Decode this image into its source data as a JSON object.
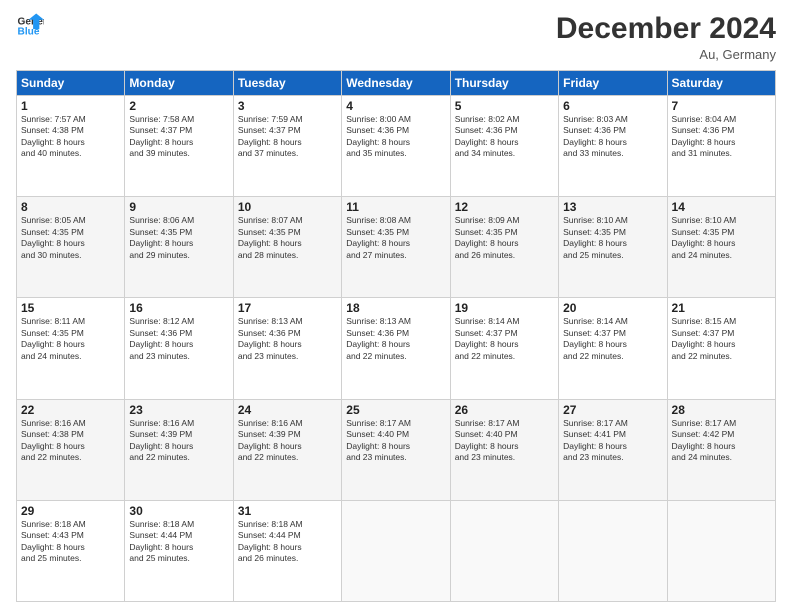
{
  "logo": {
    "line1": "General",
    "line2": "Blue"
  },
  "title": "December 2024",
  "subtitle": "Au, Germany",
  "header_days": [
    "Sunday",
    "Monday",
    "Tuesday",
    "Wednesday",
    "Thursday",
    "Friday",
    "Saturday"
  ],
  "weeks": [
    [
      {
        "day": "1",
        "lines": [
          "Sunrise: 7:57 AM",
          "Sunset: 4:38 PM",
          "Daylight: 8 hours",
          "and 40 minutes."
        ]
      },
      {
        "day": "2",
        "lines": [
          "Sunrise: 7:58 AM",
          "Sunset: 4:37 PM",
          "Daylight: 8 hours",
          "and 39 minutes."
        ]
      },
      {
        "day": "3",
        "lines": [
          "Sunrise: 7:59 AM",
          "Sunset: 4:37 PM",
          "Daylight: 8 hours",
          "and 37 minutes."
        ]
      },
      {
        "day": "4",
        "lines": [
          "Sunrise: 8:00 AM",
          "Sunset: 4:36 PM",
          "Daylight: 8 hours",
          "and 35 minutes."
        ]
      },
      {
        "day": "5",
        "lines": [
          "Sunrise: 8:02 AM",
          "Sunset: 4:36 PM",
          "Daylight: 8 hours",
          "and 34 minutes."
        ]
      },
      {
        "day": "6",
        "lines": [
          "Sunrise: 8:03 AM",
          "Sunset: 4:36 PM",
          "Daylight: 8 hours",
          "and 33 minutes."
        ]
      },
      {
        "day": "7",
        "lines": [
          "Sunrise: 8:04 AM",
          "Sunset: 4:36 PM",
          "Daylight: 8 hours",
          "and 31 minutes."
        ]
      }
    ],
    [
      {
        "day": "8",
        "lines": [
          "Sunrise: 8:05 AM",
          "Sunset: 4:35 PM",
          "Daylight: 8 hours",
          "and 30 minutes."
        ]
      },
      {
        "day": "9",
        "lines": [
          "Sunrise: 8:06 AM",
          "Sunset: 4:35 PM",
          "Daylight: 8 hours",
          "and 29 minutes."
        ]
      },
      {
        "day": "10",
        "lines": [
          "Sunrise: 8:07 AM",
          "Sunset: 4:35 PM",
          "Daylight: 8 hours",
          "and 28 minutes."
        ]
      },
      {
        "day": "11",
        "lines": [
          "Sunrise: 8:08 AM",
          "Sunset: 4:35 PM",
          "Daylight: 8 hours",
          "and 27 minutes."
        ]
      },
      {
        "day": "12",
        "lines": [
          "Sunrise: 8:09 AM",
          "Sunset: 4:35 PM",
          "Daylight: 8 hours",
          "and 26 minutes."
        ]
      },
      {
        "day": "13",
        "lines": [
          "Sunrise: 8:10 AM",
          "Sunset: 4:35 PM",
          "Daylight: 8 hours",
          "and 25 minutes."
        ]
      },
      {
        "day": "14",
        "lines": [
          "Sunrise: 8:10 AM",
          "Sunset: 4:35 PM",
          "Daylight: 8 hours",
          "and 24 minutes."
        ]
      }
    ],
    [
      {
        "day": "15",
        "lines": [
          "Sunrise: 8:11 AM",
          "Sunset: 4:35 PM",
          "Daylight: 8 hours",
          "and 24 minutes."
        ]
      },
      {
        "day": "16",
        "lines": [
          "Sunrise: 8:12 AM",
          "Sunset: 4:36 PM",
          "Daylight: 8 hours",
          "and 23 minutes."
        ]
      },
      {
        "day": "17",
        "lines": [
          "Sunrise: 8:13 AM",
          "Sunset: 4:36 PM",
          "Daylight: 8 hours",
          "and 23 minutes."
        ]
      },
      {
        "day": "18",
        "lines": [
          "Sunrise: 8:13 AM",
          "Sunset: 4:36 PM",
          "Daylight: 8 hours",
          "and 22 minutes."
        ]
      },
      {
        "day": "19",
        "lines": [
          "Sunrise: 8:14 AM",
          "Sunset: 4:37 PM",
          "Daylight: 8 hours",
          "and 22 minutes."
        ]
      },
      {
        "day": "20",
        "lines": [
          "Sunrise: 8:14 AM",
          "Sunset: 4:37 PM",
          "Daylight: 8 hours",
          "and 22 minutes."
        ]
      },
      {
        "day": "21",
        "lines": [
          "Sunrise: 8:15 AM",
          "Sunset: 4:37 PM",
          "Daylight: 8 hours",
          "and 22 minutes."
        ]
      }
    ],
    [
      {
        "day": "22",
        "lines": [
          "Sunrise: 8:16 AM",
          "Sunset: 4:38 PM",
          "Daylight: 8 hours",
          "and 22 minutes."
        ]
      },
      {
        "day": "23",
        "lines": [
          "Sunrise: 8:16 AM",
          "Sunset: 4:39 PM",
          "Daylight: 8 hours",
          "and 22 minutes."
        ]
      },
      {
        "day": "24",
        "lines": [
          "Sunrise: 8:16 AM",
          "Sunset: 4:39 PM",
          "Daylight: 8 hours",
          "and 22 minutes."
        ]
      },
      {
        "day": "25",
        "lines": [
          "Sunrise: 8:17 AM",
          "Sunset: 4:40 PM",
          "Daylight: 8 hours",
          "and 23 minutes."
        ]
      },
      {
        "day": "26",
        "lines": [
          "Sunrise: 8:17 AM",
          "Sunset: 4:40 PM",
          "Daylight: 8 hours",
          "and 23 minutes."
        ]
      },
      {
        "day": "27",
        "lines": [
          "Sunrise: 8:17 AM",
          "Sunset: 4:41 PM",
          "Daylight: 8 hours",
          "and 23 minutes."
        ]
      },
      {
        "day": "28",
        "lines": [
          "Sunrise: 8:17 AM",
          "Sunset: 4:42 PM",
          "Daylight: 8 hours",
          "and 24 minutes."
        ]
      }
    ],
    [
      {
        "day": "29",
        "lines": [
          "Sunrise: 8:18 AM",
          "Sunset: 4:43 PM",
          "Daylight: 8 hours",
          "and 25 minutes."
        ]
      },
      {
        "day": "30",
        "lines": [
          "Sunrise: 8:18 AM",
          "Sunset: 4:44 PM",
          "Daylight: 8 hours",
          "and 25 minutes."
        ]
      },
      {
        "day": "31",
        "lines": [
          "Sunrise: 8:18 AM",
          "Sunset: 4:44 PM",
          "Daylight: 8 hours",
          "and 26 minutes."
        ]
      },
      {
        "day": "",
        "lines": []
      },
      {
        "day": "",
        "lines": []
      },
      {
        "day": "",
        "lines": []
      },
      {
        "day": "",
        "lines": []
      }
    ]
  ]
}
